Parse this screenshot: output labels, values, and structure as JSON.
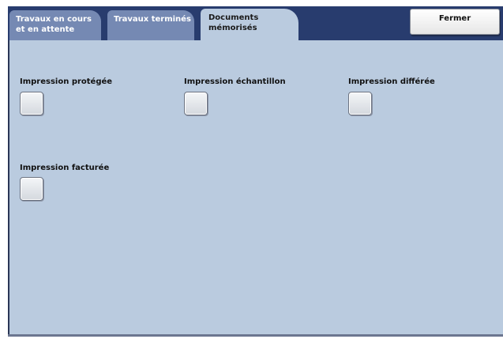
{
  "tabs": [
    {
      "label": "Travaux en cours\net en attente",
      "active": false
    },
    {
      "label": "Travaux terminés",
      "active": false
    },
    {
      "label": "Documents\nmémorisés",
      "active": true
    }
  ],
  "close_button": {
    "label": "Fermer"
  },
  "options": [
    {
      "label": "Impression protégée"
    },
    {
      "label": "Impression échantillon"
    },
    {
      "label": "Impression différée"
    },
    {
      "label": "Impression facturée"
    }
  ],
  "colors": {
    "header": "#283c6e",
    "inactive_tab": "#7589b3",
    "panel": "#bacbdf"
  }
}
